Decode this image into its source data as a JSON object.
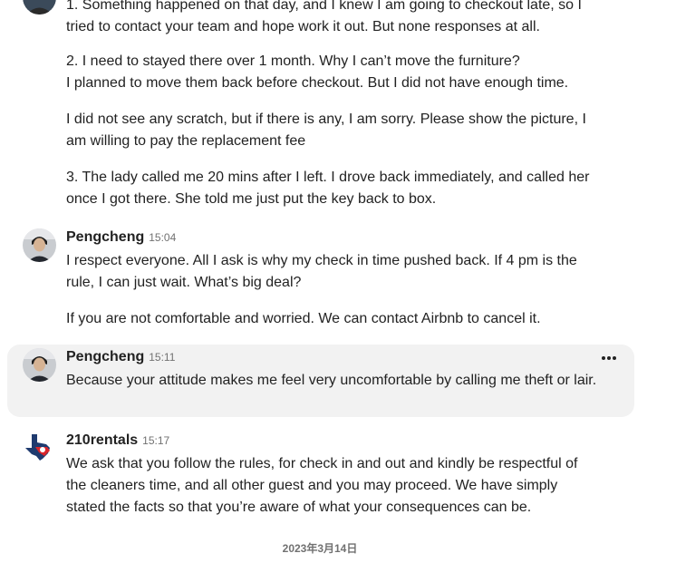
{
  "messages": [
    {
      "paragraphs": [
        "1. Something happened on that day, and I knew I am going to checkout late, so I tried to contact your team and hope work it out. But none responses at all.",
        "2. I need to stayed there over 1 month. Why I can’t move the furniture?\nI planned to move them back before checkout. But I did not have enough time.",
        "I did not see any scratch, but if there is any, I am sorry. Please show the picture, I am willing to pay the replacement fee",
        "3. The lady called me 20 mins after I left. I drove back immediately, and called her once I got there. She told me just put the key back to box."
      ]
    },
    {
      "author": "Pengcheng",
      "time": "15:04",
      "paragraphs": [
        "I respect everyone. All I ask is why my check in time pushed back. If 4 pm is the rule, I can just wait. What’s big deal?",
        "If you are not comfortable and worried. We can contact Airbnb to cancel it."
      ]
    },
    {
      "author": "Pengcheng",
      "time": "15:11",
      "paragraphs": [
        "Because your attitude makes me feel very uncomfortable by calling me theft or lair."
      ]
    },
    {
      "author": "210rentals",
      "time": "15:17",
      "paragraphs": [
        "We ask that you follow the rules, for check in and out and kindly be respectful of the cleaners time, and all other guest and you may proceed. We have simply stated the facts so that you’re aware of what your consequences can be."
      ]
    }
  ],
  "date_divider": "2023年3月14日",
  "icons": {
    "more": "ellipsis-icon"
  },
  "colors": {
    "text": "#222222",
    "muted": "#717171",
    "highlight": "#f2f2f2",
    "rentals_red": "#d9252b",
    "rentals_blue": "#1f3b6f"
  }
}
